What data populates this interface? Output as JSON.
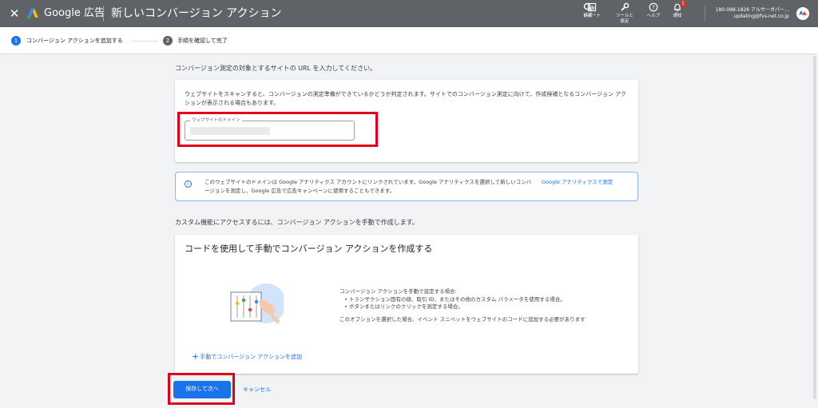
{
  "topbar": {
    "close_icon": "close-icon",
    "product": "Google 広告",
    "title": "新しいコンバージョン アクション",
    "tools": [
      {
        "icon": "search-icon",
        "label": "検索"
      },
      {
        "icon": "report-icon",
        "label": "レポート"
      },
      {
        "icon": "wrench-icon",
        "label": "ツールと\n設定"
      },
      {
        "icon": "help-icon",
        "label": "ヘルプ"
      },
      {
        "icon": "bell-icon",
        "label": "通知",
        "badge": "1"
      }
    ],
    "account_id": "180-098-1826 アルサーガパー…",
    "account_email": "updating@fvs-net.co.jp"
  },
  "stepper": {
    "steps": [
      {
        "number": "1",
        "label": "コンバージョン アクションを追加する",
        "active": true
      },
      {
        "number": "2",
        "label": "手順を確認して完了",
        "active": false
      }
    ]
  },
  "website": {
    "heading": "コンバージョン測定の対象とするサイトの URL を入力してください。",
    "scan_text": "ウェブサイトをスキャンすると、コンバージョンの測定準備ができているかどうか判定されます。サイトでのコンバージョン測定に向けて、作成候補となるコンバージョン アクションが表示される場合もあります。",
    "domain_label": "ウェブサイトのドメイン",
    "domain_value": ""
  },
  "info": {
    "text": "このウェブサイトのドメインは Google アナリティクス アカウントにリンクされています。Google アナリティクスを選択して新しいコンバージョンを測定し、Google 広告で広告キャンペーンに使用することもできます。",
    "link": "Google アナリティクスで測定"
  },
  "manual": {
    "heading": "カスタム機能にアクセスするには、コンバージョン アクションを手動で作成します。",
    "title": "コードを使用して手動でコンバージョン アクションを作成する",
    "desc_intro": "コンバージョン アクションを手動で設定する場合:",
    "bullets": [
      "トランザクション固有の値、取引 ID、またはその他のカスタム パラメータを使用する場合。",
      "ボタンまたはリンクのクリックを測定する場合。"
    ],
    "note": "このオプションを選択した場合、イベント スニペットをウェブサイトのコードに追加する必要があります",
    "add_link": "手動でコンバージョン アクションを追加"
  },
  "actions": {
    "save_next": "保存して次へ",
    "cancel": "キャンセル"
  },
  "colors": {
    "topbar": "#5f6368",
    "primary": "#1a73e8",
    "highlight": "#e0001b",
    "background": "#f1f3f4"
  }
}
